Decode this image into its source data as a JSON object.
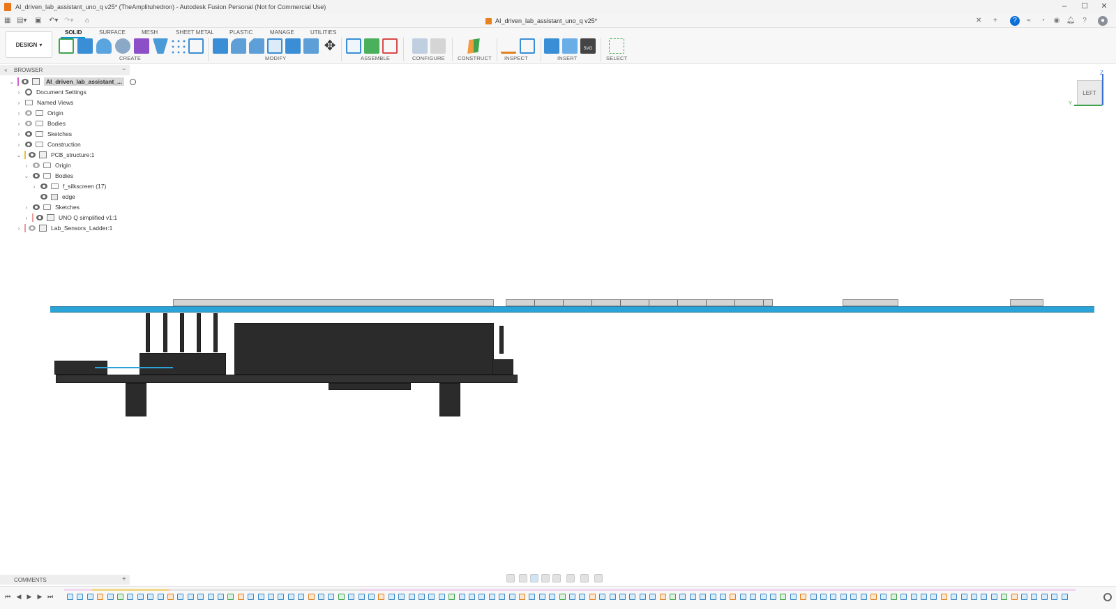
{
  "window": {
    "title": "AI_driven_lab_assistant_uno_q v25* (TheAmplituhedron) - Autodesk Fusion Personal (Not for Commercial Use)"
  },
  "appbar": {
    "document_tab": "AI_driven_lab_assistant_uno_q v25*"
  },
  "ribbon": {
    "workspace": "DESIGN",
    "tabs": [
      "SOLID",
      "SURFACE",
      "MESH",
      "SHEET METAL",
      "PLASTIC",
      "MANAGE",
      "UTILITIES"
    ],
    "active_tab": "SOLID",
    "groups": [
      "CREATE",
      "MODIFY",
      "ASSEMBLE",
      "CONFIGURE",
      "CONSTRUCT",
      "INSPECT",
      "INSERT",
      "SELECT"
    ]
  },
  "browser": {
    "title": "BROWSER",
    "items": [
      {
        "label": "AI_driven_lab_assistant_...",
        "expanded": true,
        "selected": true
      },
      {
        "label": "Document Settings"
      },
      {
        "label": "Named Views"
      },
      {
        "label": "Origin"
      },
      {
        "label": "Bodies"
      },
      {
        "label": "Sketches"
      },
      {
        "label": "Construction"
      },
      {
        "label": "PCB_structure:1",
        "expanded": true
      },
      {
        "label": "Origin"
      },
      {
        "label": "Bodies",
        "expanded": true
      },
      {
        "label": "f_silkscreen (17)"
      },
      {
        "label": "edge"
      },
      {
        "label": "Sketches"
      },
      {
        "label": "UNO Q simplified v1:1"
      },
      {
        "label": "Lab_Sensors_Ladder:1"
      }
    ]
  },
  "viewcube": {
    "face": "LEFT",
    "axis_top": "Z",
    "axis_left": "Y"
  },
  "comments": {
    "title": "COMMENTS"
  },
  "colors": {
    "accent": "#0696d7",
    "pcb": "#2aa3d6",
    "component_dark": "#2b2b2b"
  },
  "icons": {
    "design_chevron": "▾",
    "add": "+"
  }
}
